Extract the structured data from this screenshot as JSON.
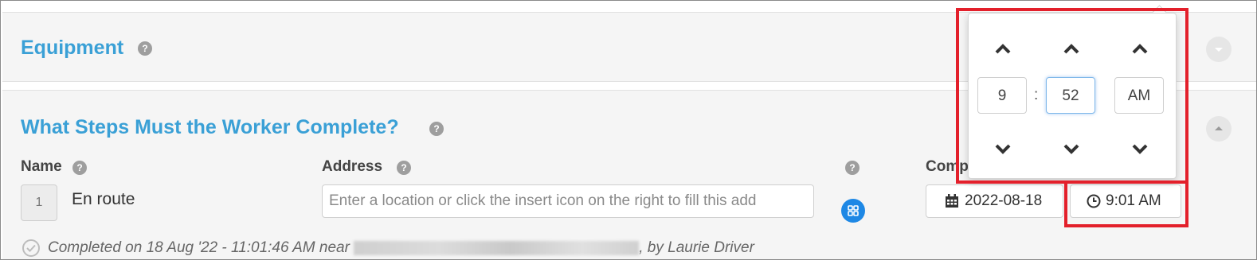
{
  "equipment": {
    "title": "Equipment",
    "help": "?"
  },
  "steps": {
    "title": "What Steps Must the Worker Complete?",
    "help": "?",
    "columns": {
      "name": "Name",
      "address": "Address",
      "completed": "Comp"
    },
    "row": {
      "number": "1",
      "name": "En route",
      "address_placeholder": "Enter a location or click the insert icon on the right to fill this add",
      "date": "2022-08-18",
      "time": "9:01 AM"
    },
    "completed_prefix": "Completed on 18 Aug '22 - 11:01:46 AM near",
    "completed_suffix": ", by Laurie Driver"
  },
  "time_picker": {
    "hour": "9",
    "minute": "52",
    "separator": ":",
    "period": "AM"
  },
  "colors": {
    "accent": "#3aa0d6",
    "button_blue": "#1e88e5",
    "highlight_red": "#e3202b"
  },
  "icons": [
    "help-icon",
    "chevron-up-icon",
    "chevron-down-icon",
    "calendar-icon",
    "clock-icon",
    "grid-insert-icon",
    "check-circle-icon"
  ]
}
